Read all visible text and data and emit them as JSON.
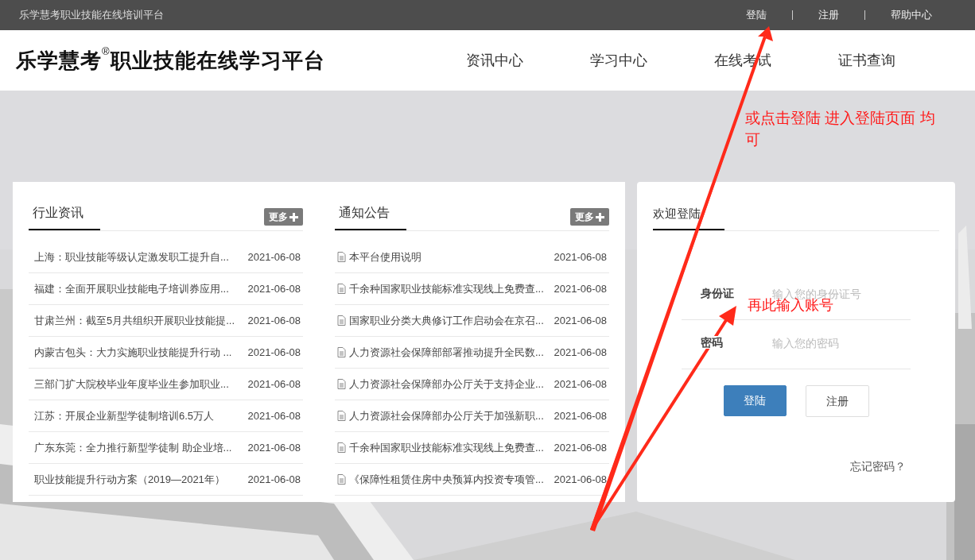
{
  "top_bar": {
    "title": "乐学慧考职业技能在线培训平台",
    "links": [
      "登陆",
      "注册",
      "帮助中心"
    ]
  },
  "header": {
    "logo": "乐学慧考",
    "logo_mark": "®",
    "logo_suffix": "职业技能在线学习平台",
    "nav": [
      "资讯中心",
      "学习中心",
      "在线考试",
      "证书查询"
    ]
  },
  "panels": [
    {
      "title": "行业资讯",
      "more": "更多",
      "kind": "plain",
      "items": [
        {
          "title": "上海：职业技能等级认定激发职工提升自...",
          "date": "2021-06-08"
        },
        {
          "title": "福建：全面开展职业技能电子培训券应用...",
          "date": "2021-06-08"
        },
        {
          "title": "甘肃兰州：截至5月共组织开展职业技能提...",
          "date": "2021-06-08"
        },
        {
          "title": "内蒙古包头：大力实施职业技能提升行动 ...",
          "date": "2021-06-08"
        },
        {
          "title": "三部门扩大院校毕业年度毕业生参加职业...",
          "date": "2021-06-08"
        },
        {
          "title": "江苏：开展企业新型学徒制培训6.5万人",
          "date": "2021-06-08"
        },
        {
          "title": "广东东莞：全力推行新型学徒制 助企业培...",
          "date": "2021-06-08"
        },
        {
          "title": "职业技能提升行动方案（2019—2021年）",
          "date": "2021-06-08"
        }
      ]
    },
    {
      "title": "通知公告",
      "more": "更多",
      "kind": "document",
      "items": [
        {
          "title": "本平台使用说明",
          "date": "2021-06-08"
        },
        {
          "title": "千余种国家职业技能标准实现线上免费查...",
          "date": "2021-06-08"
        },
        {
          "title": "国家职业分类大典修订工作启动会在京召...",
          "date": "2021-06-08"
        },
        {
          "title": "人力资源社会保障部部署推动提升全民数...",
          "date": "2021-06-08"
        },
        {
          "title": "人力资源社会保障部办公厅关于支持企业...",
          "date": "2021-06-08"
        },
        {
          "title": "人力资源社会保障部办公厅关于加强新职...",
          "date": "2021-06-08"
        },
        {
          "title": "千余种国家职业技能标准实现线上免费查...",
          "date": "2021-06-08"
        },
        {
          "title": "《保障性租赁住房中央预算内投资专项管...",
          "date": "2021-06-08"
        }
      ]
    }
  ],
  "login": {
    "title": "欢迎登陆",
    "fields": [
      {
        "label": "身份证",
        "placeholder": "输入您的身份证号"
      },
      {
        "label": "密码",
        "placeholder": "输入您的密码"
      }
    ],
    "buttons": [
      {
        "label": "登陆",
        "kind": "primary"
      },
      {
        "label": "注册",
        "kind": "secondary"
      }
    ],
    "forgot": "忘记密码？"
  },
  "annotations": [
    {
      "text": "或点击登陆 进入登陆页面 均可"
    },
    {
      "text": "再此输入账号"
    }
  ]
}
